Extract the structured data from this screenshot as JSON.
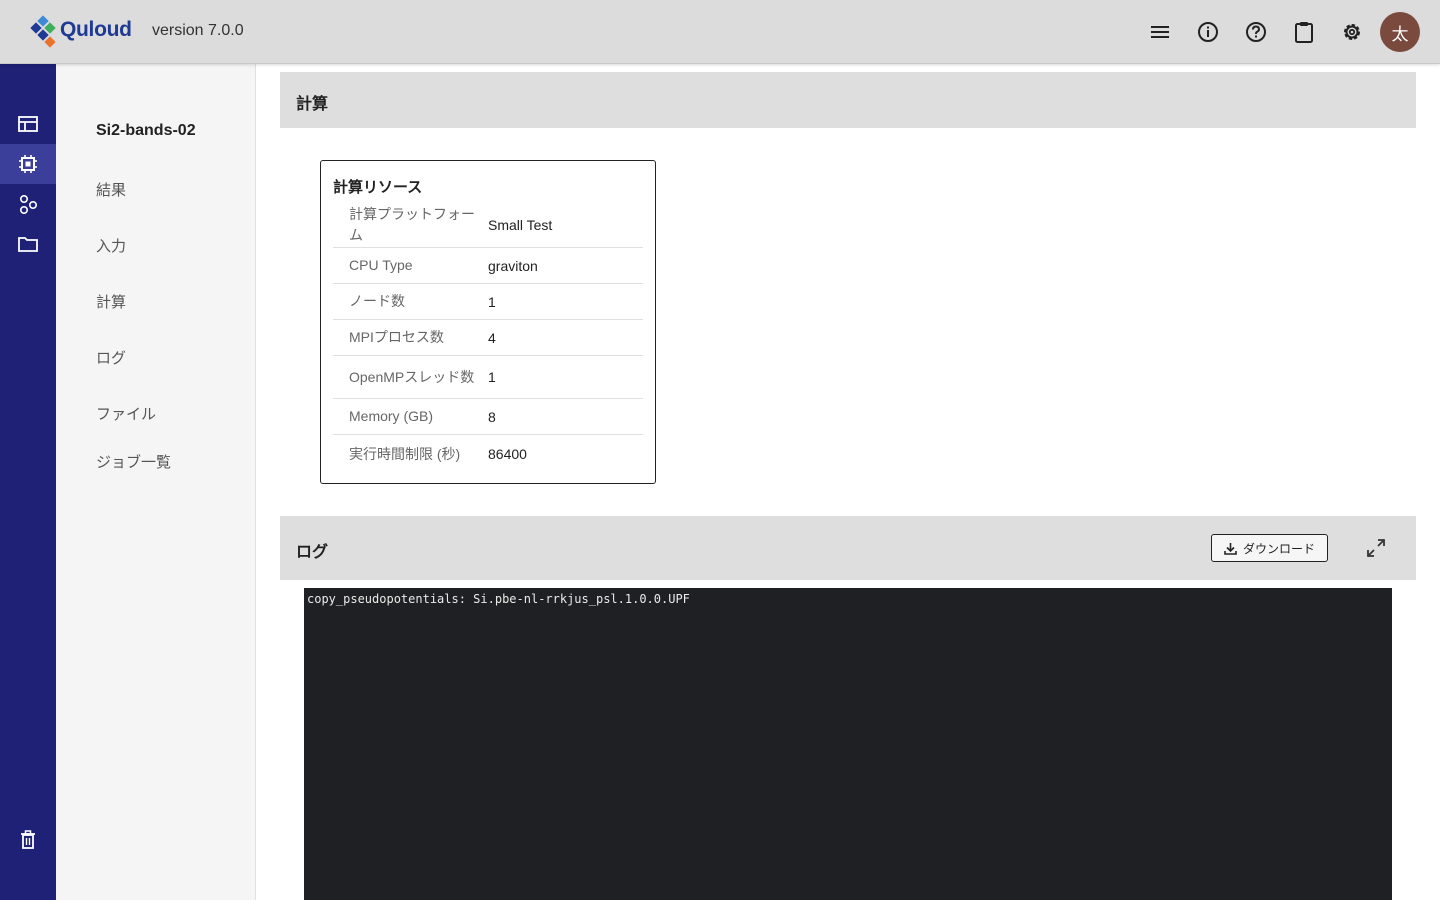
{
  "header": {
    "brand": "Quloud",
    "version": "version 7.0.0",
    "icons": [
      "menu-icon",
      "info-icon",
      "help-icon",
      "clipboard-icon",
      "settings-icon"
    ],
    "avatar_initial": "太",
    "colors": {
      "bar": "#dcdcdc",
      "brand_text": "#1f3a93",
      "avatar": "#7a4a3e"
    }
  },
  "rail": {
    "items": [
      "table-icon",
      "processor-icon",
      "workflow-icon",
      "folder-icon"
    ],
    "active": "processor-icon",
    "bottom": "trash-icon",
    "color": "#1e2176"
  },
  "subnav": {
    "project": "Si2-bands-02",
    "items": [
      "結果",
      "入力",
      "計算",
      "ログ",
      "ファイル",
      "ジョブ一覧"
    ]
  },
  "compute": {
    "section_title": "計算",
    "resource_title": "計算リソース",
    "rows": [
      {
        "label": "計算プラットフォーム",
        "value": "Small Test"
      },
      {
        "label": "CPU Type",
        "value": "graviton"
      },
      {
        "label": "ノード数",
        "value": "1"
      },
      {
        "label": "MPIプロセス数",
        "value": "4"
      },
      {
        "label": "OpenMPスレッド数",
        "value": "1"
      },
      {
        "label": "Memory (GB)",
        "value": "8"
      },
      {
        "label": "実行時間制限 (秒)",
        "value": "86400"
      }
    ]
  },
  "log": {
    "section_title": "ログ",
    "download_label": "ダウンロード",
    "content": "copy_pseudopotentials: Si.pbe-nl-rrkjus_psl.1.0.0.UPF",
    "background": "#1f2023"
  }
}
